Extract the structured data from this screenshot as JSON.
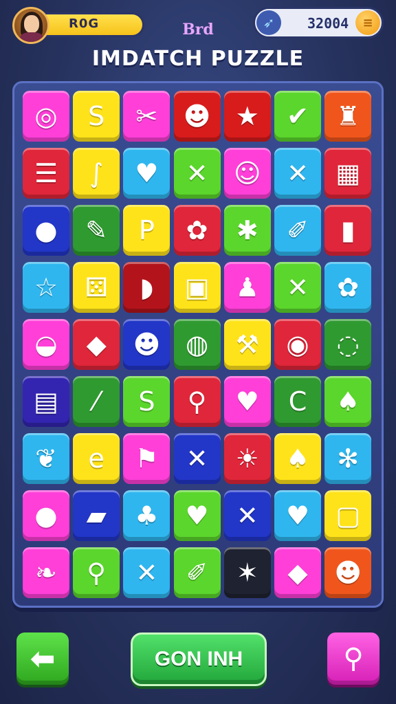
{
  "player": {
    "name": "R0G"
  },
  "score": {
    "value": "32004"
  },
  "header": {
    "subtitle": "Brd",
    "title": "IMDATCH PUZZLE"
  },
  "buttons": {
    "main_label": "GON INH"
  },
  "icons": {
    "back": "arrow-left-icon",
    "search": "search-icon",
    "boost": "rocket-icon",
    "coin": "coin-icon"
  },
  "board": {
    "rows": 9,
    "cols": 7,
    "tiles": [
      [
        {
          "bg": "#ff3fd8",
          "g": "◎",
          "icon": "donut"
        },
        {
          "bg": "#ffe31a",
          "g": "S",
          "icon": "swirl"
        },
        {
          "bg": "#ff3fd8",
          "g": "✂",
          "icon": "scissors"
        },
        {
          "bg": "#d81c1c",
          "g": "☻",
          "icon": "cow"
        },
        {
          "bg": "#d81c1c",
          "g": "★",
          "icon": "star"
        },
        {
          "bg": "#5bd62c",
          "g": "✔",
          "icon": "check"
        },
        {
          "bg": "#f0561c",
          "g": "♜",
          "icon": "bottle"
        }
      ],
      [
        {
          "bg": "#e0263a",
          "g": "☰",
          "icon": "lines"
        },
        {
          "bg": "#ffe31a",
          "g": "∫",
          "icon": "worm"
        },
        {
          "bg": "#2fb6ef",
          "g": "♥",
          "icon": "heart"
        },
        {
          "bg": "#5bd62c",
          "g": "✕",
          "icon": "x"
        },
        {
          "bg": "#ff3fd8",
          "g": "☺",
          "icon": "ghost"
        },
        {
          "bg": "#2fb6ef",
          "g": "✕",
          "icon": "cross-sticks"
        },
        {
          "bg": "#e0263a",
          "g": "▦",
          "icon": "calculator"
        }
      ],
      [
        {
          "bg": "#2236c8",
          "g": "●",
          "icon": "orange-ball"
        },
        {
          "bg": "#2f9a30",
          "g": "✎",
          "icon": "marker"
        },
        {
          "bg": "#ffe31a",
          "g": "P",
          "icon": "letter-p"
        },
        {
          "bg": "#e0263a",
          "g": "✿",
          "icon": "flower"
        },
        {
          "bg": "#5bd62c",
          "g": "✱",
          "icon": "asterisk"
        },
        {
          "bg": "#2fb6ef",
          "g": "✐",
          "icon": "pencil"
        },
        {
          "bg": "#e0263a",
          "g": "▮",
          "icon": "crayon"
        }
      ],
      [
        {
          "bg": "#2fb6ef",
          "g": "☆",
          "icon": "star-outline"
        },
        {
          "bg": "#ffe31a",
          "g": "⚄",
          "icon": "cheese"
        },
        {
          "bg": "#b3141c",
          "g": "◗",
          "icon": "bowl"
        },
        {
          "bg": "#ffe31a",
          "g": "▣",
          "icon": "bag"
        },
        {
          "bg": "#ff3fd8",
          "g": "♟",
          "icon": "pawn"
        },
        {
          "bg": "#5bd62c",
          "g": "✕",
          "icon": "x-pink"
        },
        {
          "bg": "#2fb6ef",
          "g": "✿",
          "icon": "gear-flower"
        }
      ],
      [
        {
          "bg": "#ff3fd8",
          "g": "◒",
          "icon": "eraser"
        },
        {
          "bg": "#e0263a",
          "g": "◆",
          "icon": "kite"
        },
        {
          "bg": "#2236c8",
          "g": "☻",
          "icon": "critter"
        },
        {
          "bg": "#2f9a30",
          "g": "◍",
          "icon": "ring"
        },
        {
          "bg": "#ffe31a",
          "g": "⚒",
          "icon": "wrench"
        },
        {
          "bg": "#e0263a",
          "g": "◉",
          "icon": "target"
        },
        {
          "bg": "#2f9a30",
          "g": "◌",
          "icon": "speech"
        }
      ],
      [
        {
          "bg": "#3325b0",
          "g": "▤",
          "icon": "battery"
        },
        {
          "bg": "#2f9a30",
          "g": "⁄",
          "icon": "slash"
        },
        {
          "bg": "#5bd62c",
          "g": "S",
          "icon": "swirl-pink"
        },
        {
          "bg": "#e0263a",
          "g": "⚲",
          "icon": "brush"
        },
        {
          "bg": "#ff3fd8",
          "g": "♥",
          "icon": "heart-purple"
        },
        {
          "bg": "#2f9a30",
          "g": "C",
          "icon": "letter-c"
        },
        {
          "bg": "#5bd62c",
          "g": "♠",
          "icon": "squash"
        }
      ],
      [
        {
          "bg": "#2fb6ef",
          "g": "❦",
          "icon": "leaf"
        },
        {
          "bg": "#ffe31a",
          "g": "e",
          "icon": "letter-e"
        },
        {
          "bg": "#ff3fd8",
          "g": "⚑",
          "icon": "hammer"
        },
        {
          "bg": "#2236c8",
          "g": "✕",
          "icon": "x-purple"
        },
        {
          "bg": "#e0263a",
          "g": "☀",
          "icon": "sun"
        },
        {
          "bg": "#ffe31a",
          "g": "♠",
          "icon": "pepper"
        },
        {
          "bg": "#2fb6ef",
          "g": "✻",
          "icon": "snowflake"
        }
      ],
      [
        {
          "bg": "#ff3fd8",
          "g": "●",
          "icon": "orange"
        },
        {
          "bg": "#2236c8",
          "g": "▰",
          "icon": "tube"
        },
        {
          "bg": "#2fb6ef",
          "g": "♣",
          "icon": "carrot"
        },
        {
          "bg": "#5bd62c",
          "g": "♥",
          "icon": "heart-red"
        },
        {
          "bg": "#2236c8",
          "g": "✕",
          "icon": "x-yellow"
        },
        {
          "bg": "#2fb6ef",
          "g": "♥",
          "icon": "heart-rainbow"
        },
        {
          "bg": "#ffe31a",
          "g": "▢",
          "icon": "jar"
        }
      ],
      [
        {
          "bg": "#ff3fd8",
          "g": "❧",
          "icon": "leaf-green"
        },
        {
          "bg": "#5bd62c",
          "g": "⚲",
          "icon": "pushpin"
        },
        {
          "bg": "#2fb6ef",
          "g": "✕",
          "icon": "x-red"
        },
        {
          "bg": "#5bd62c",
          "g": "✐",
          "icon": "chisel"
        },
        {
          "bg": "#1f2230",
          "g": "✶",
          "icon": "star-white"
        },
        {
          "bg": "#ff3fd8",
          "g": "◆",
          "icon": "gem-red"
        },
        {
          "bg": "#f0561c",
          "g": "☻",
          "icon": "bear"
        }
      ]
    ]
  }
}
